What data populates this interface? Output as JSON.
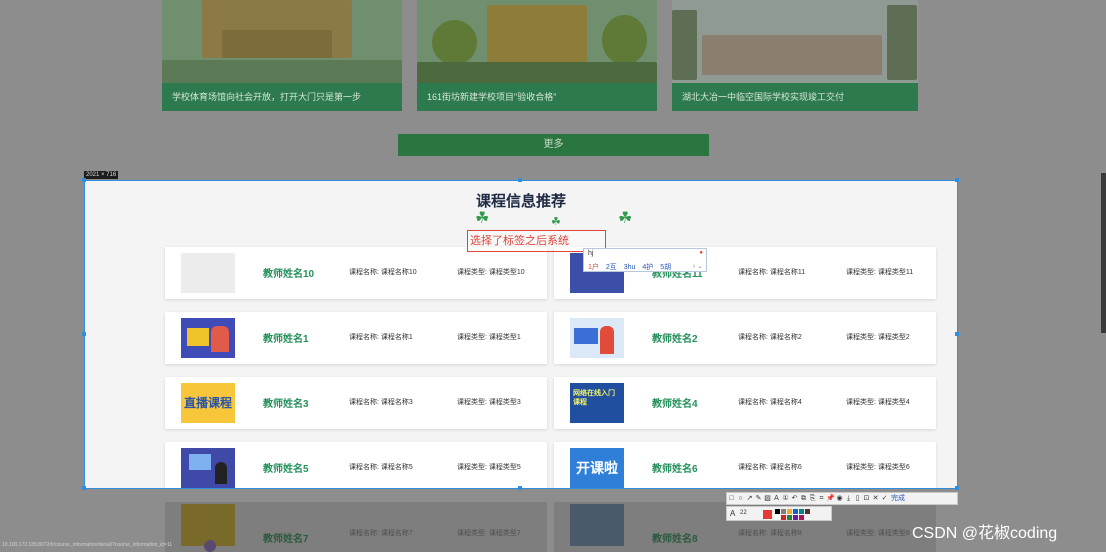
{
  "news": {
    "captions": [
      "学校体育场馆向社会开放，打开大门只是第一步",
      "161街坊新建学校项目\"验收合格\"",
      "湖北大冶一中临空国际学校实现竣工交付"
    ],
    "more_label": "更多"
  },
  "capture": {
    "size_label": "2021 × 716"
  },
  "section": {
    "title": "课程信息推荐",
    "clover_icon": "clover-icon"
  },
  "tag_overlay": {
    "text": "选择了标签之后系统"
  },
  "ime": {
    "input": "hj",
    "candidates": [
      "1户",
      "2互",
      "3hu",
      "4护",
      "5胡"
    ],
    "more": "› ⌄"
  },
  "courses": [
    {
      "teacher": "教师姓名10",
      "name_label": "课程名称: 课程名称10",
      "type_label": "课程类型: 课程类型10"
    },
    {
      "teacher": "教师姓名11",
      "name_label": "课程名称: 课程名称11",
      "type_label": "课程类型: 课程类型11"
    },
    {
      "teacher": "教师姓名1",
      "name_label": "课程名称: 课程名称1",
      "type_label": "课程类型: 课程类型1"
    },
    {
      "teacher": "教师姓名2",
      "name_label": "课程名称: 课程名称2",
      "type_label": "课程类型: 课程类型2"
    },
    {
      "teacher": "教师姓名3",
      "name_label": "课程名称: 课程名称3",
      "type_label": "课程类型: 课程类型3"
    },
    {
      "teacher": "教师姓名4",
      "name_label": "课程名称: 课程名称4",
      "type_label": "课程类型: 课程类型4"
    },
    {
      "teacher": "教师姓名5",
      "name_label": "课程名称: 课程名称5",
      "type_label": "课程类型: 课程类型5"
    },
    {
      "teacher": "教师姓名6",
      "name_label": "课程名称: 课程名称6",
      "type_label": "课程类型: 课程类型6"
    }
  ],
  "thumb_texts": {
    "c3": "直播课程",
    "c4": "网络在线入门课程",
    "c6": "开课啦"
  },
  "dim_courses": [
    {
      "teacher": "教师姓名7",
      "name_label": "课程名称: 课程名称7",
      "type_label": "课程类型: 课程类型7"
    },
    {
      "teacher": "教师姓名8",
      "name_label": "课程名称: 课程名称8",
      "type_label": "课程类型: 课程类型8"
    }
  ],
  "toolbar": {
    "icons": [
      "□",
      "○",
      "↗",
      "✎",
      "▨",
      "A",
      "①",
      "↶",
      "⧉",
      "⎘",
      "⌗",
      "📌",
      "◉",
      "⤓",
      "▯",
      "⊡",
      "✕",
      "✓"
    ],
    "done_label": "完成",
    "font_label": "A",
    "size_value": "22",
    "colors": [
      "#e53935",
      "#000000",
      "#ffffff",
      "#7f7f7f",
      "#c62828",
      "#f9a825",
      "#2e7d32",
      "#1565c0",
      "#6a1b9a",
      "#00838f",
      "#ad1457",
      "#4e342e"
    ]
  },
  "status_url": "10.100.172.185:8072/#/course_information/detail/?course_information_id=11",
  "watermark": "CSDN @花椒coding"
}
